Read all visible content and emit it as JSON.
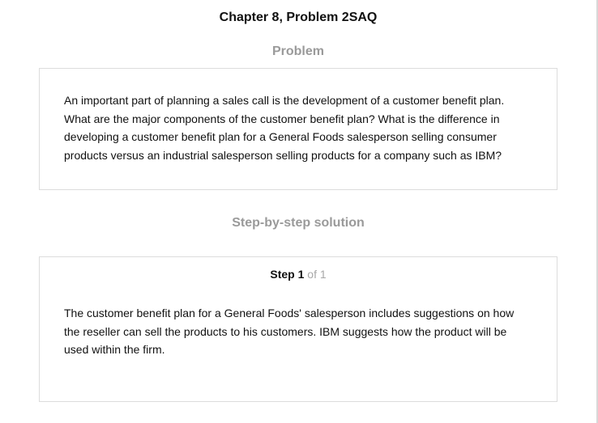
{
  "header": {
    "title": "Chapter 8, Problem 2SAQ"
  },
  "problem": {
    "heading": "Problem",
    "text": "An important part of planning a sales call is the development of a customer benefit plan. What are the major components of the customer benefit plan? What is the difference in developing a customer benefit plan for a General Foods salesperson selling consumer products versus an industrial salesperson selling products for a company such as IBM?"
  },
  "solution": {
    "heading": "Step-by-step solution",
    "step": {
      "word": "Step",
      "number": "1",
      "of_text": "of 1"
    },
    "text": "The customer benefit plan for a General Foods' salesperson includes suggestions on how the reseller can sell the products to his customers. IBM suggests how the product will be used within the firm."
  }
}
